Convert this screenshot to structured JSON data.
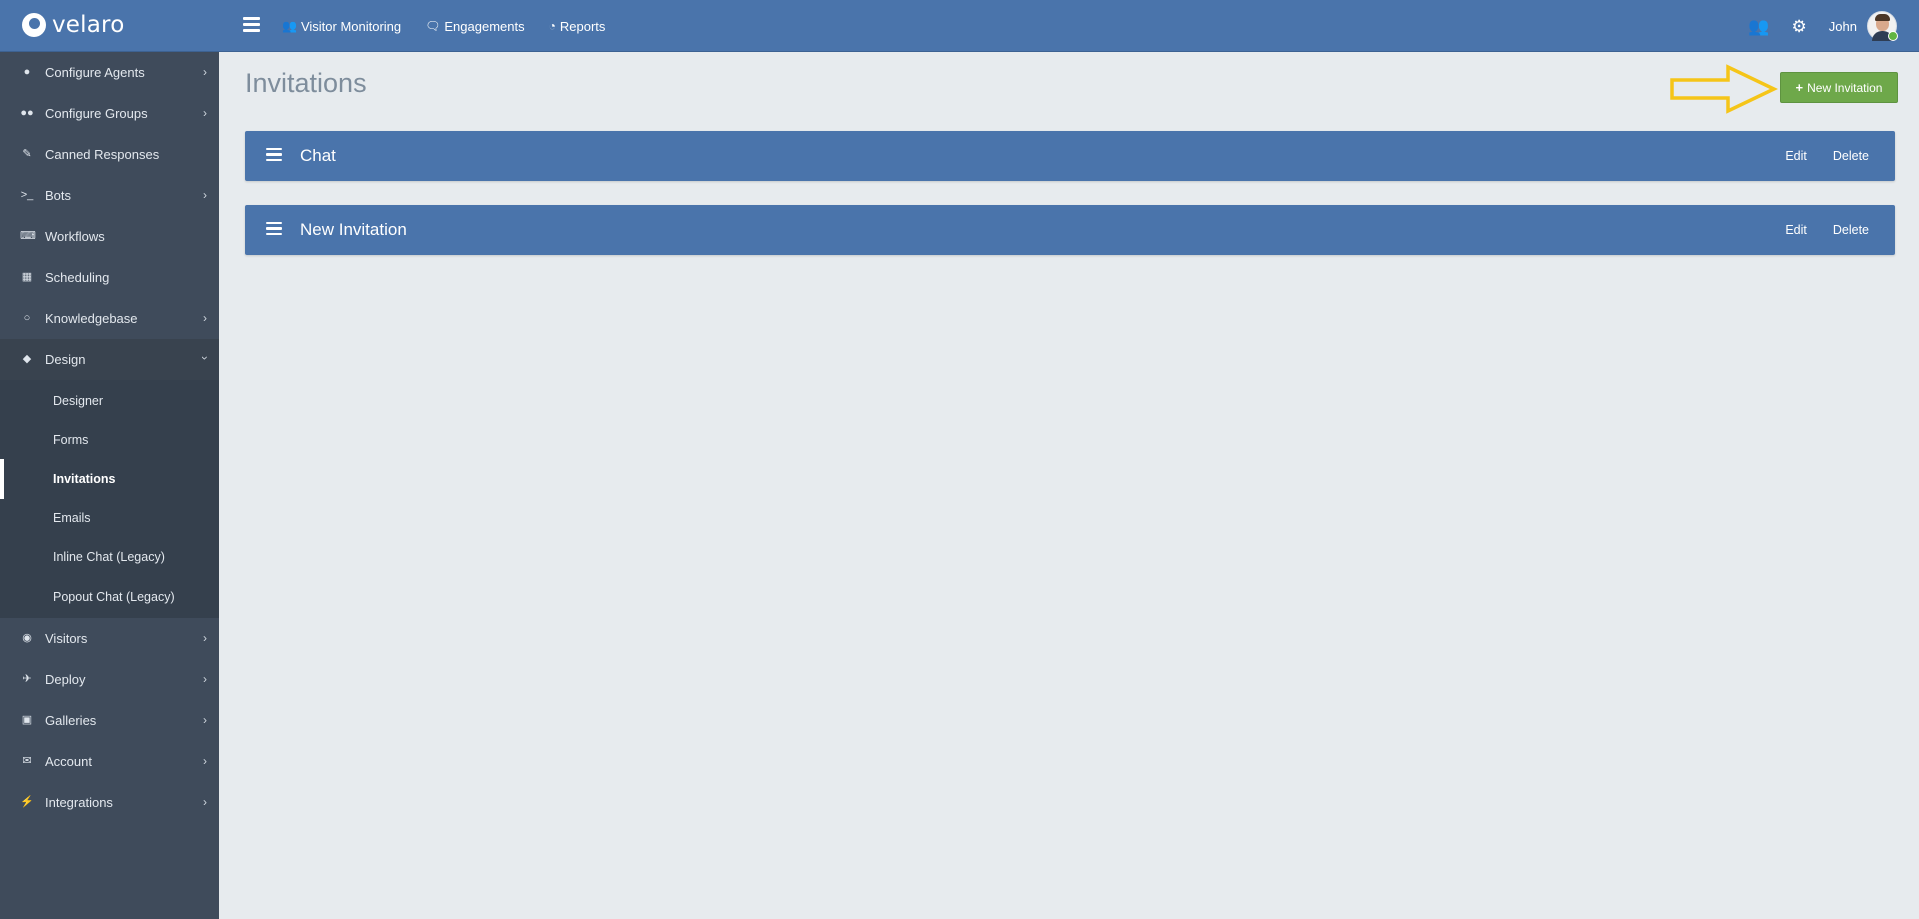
{
  "app": {
    "logo_text": "velaro"
  },
  "topnav": [
    {
      "label": "Visitor Monitoring",
      "icon": "users-icon"
    },
    {
      "label": "Engagements",
      "icon": "chat-bubble-icon"
    },
    {
      "label": "Reports",
      "icon": "pie-chart-icon"
    }
  ],
  "user": {
    "name": "John",
    "status_color": "#62b543"
  },
  "sidebar": {
    "items": [
      {
        "label": "Configure Agents",
        "icon": "user-icon",
        "has_children": true
      },
      {
        "label": "Configure Groups",
        "icon": "users-icon",
        "has_children": true
      },
      {
        "label": "Canned Responses",
        "icon": "edit-icon",
        "has_children": false
      },
      {
        "label": "Bots",
        "icon": "terminal-icon",
        "has_children": true
      },
      {
        "label": "Workflows",
        "icon": "keyboard-icon",
        "has_children": false
      },
      {
        "label": "Scheduling",
        "icon": "calendar-icon",
        "has_children": false
      },
      {
        "label": "Knowledgebase",
        "icon": "lightbulb-icon",
        "has_children": true
      },
      {
        "label": "Design",
        "icon": "diamond-icon",
        "has_children": true,
        "expanded": true
      },
      {
        "label": "Visitors",
        "icon": "eye-icon",
        "has_children": true
      },
      {
        "label": "Deploy",
        "icon": "plane-icon",
        "has_children": true
      },
      {
        "label": "Galleries",
        "icon": "image-icon",
        "has_children": true
      },
      {
        "label": "Account",
        "icon": "envelope-icon",
        "has_children": true
      },
      {
        "label": "Integrations",
        "icon": "plug-icon",
        "has_children": true
      }
    ],
    "design_submenu": [
      {
        "label": "Designer"
      },
      {
        "label": "Forms"
      },
      {
        "label": "Invitations",
        "active": true
      },
      {
        "label": "Emails"
      },
      {
        "label": "Inline Chat (Legacy)"
      },
      {
        "label": "Popout Chat (Legacy)"
      }
    ]
  },
  "main": {
    "title": "Invitations",
    "new_button_label": "New Invitation",
    "invitations": [
      {
        "name": "Chat",
        "edit_label": "Edit",
        "delete_label": "Delete"
      },
      {
        "name": "New Invitation",
        "edit_label": "Edit",
        "delete_label": "Delete"
      }
    ]
  },
  "colors": {
    "header": "#4a74ab",
    "sidebar": "#3f4b5b",
    "content_bg": "#e7ebee",
    "accent_green": "#6ea84a",
    "callout_arrow": "#f5c518"
  }
}
